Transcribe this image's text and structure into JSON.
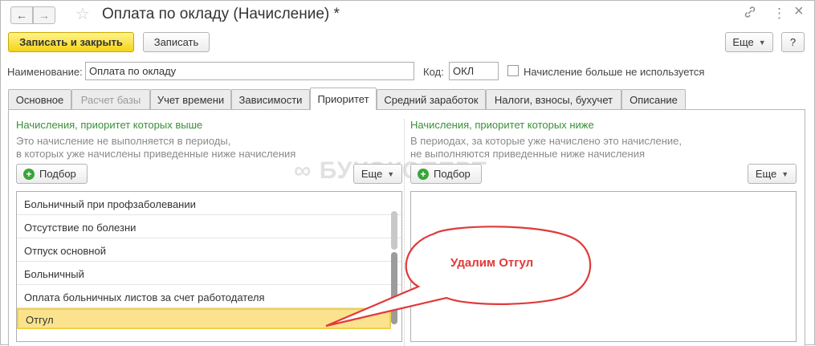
{
  "window": {
    "title": "Оплата по окладу (Начисление) *",
    "back_icon": "←",
    "forward_icon": "→",
    "star_icon": "☆",
    "link_icon": "🔗",
    "more_icon": "⋮",
    "close_icon": "×"
  },
  "toolbar": {
    "save_close_label": "Записать и закрыть",
    "save_label": "Записать",
    "more_label": "Еще",
    "help_label": "?"
  },
  "fields": {
    "name_label": "Наименование:",
    "name_value": "Оплата по окладу",
    "code_label": "Код:",
    "code_value": "ОКЛ",
    "unused_label": "Начисление больше не используется",
    "unused_checked": false
  },
  "tabs": [
    {
      "label": "Основное",
      "state": "normal"
    },
    {
      "label": "Расчет базы",
      "state": "disabled"
    },
    {
      "label": "Учет времени",
      "state": "normal"
    },
    {
      "label": "Зависимости",
      "state": "normal"
    },
    {
      "label": "Приоритет",
      "state": "active"
    },
    {
      "label": "Средний заработок",
      "state": "normal"
    },
    {
      "label": "Налоги, взносы, бухучет",
      "state": "normal"
    },
    {
      "label": "Описание",
      "state": "normal"
    }
  ],
  "left": {
    "heading": "Начисления, приоритет которых выше",
    "desc_line1": "Это начисление не выполняется в периоды,",
    "desc_line2": "в которых уже начислены приведенные ниже начисления",
    "pick_label": "Подбор",
    "more_label": "Еще",
    "items": [
      "Больничный при профзаболевании",
      "Отсутствие по болезни",
      "Отпуск основной",
      "Больничный",
      "Оплата больничных листов за счет работодателя",
      "Отгул"
    ],
    "selected_index": 5
  },
  "right": {
    "heading": "Начисления, приоритет которых ниже",
    "desc_line1": "В периодах, за которые уже начислено это начисление,",
    "desc_line2": "не выполняются приведенные ниже начисления",
    "pick_label": "Подбор",
    "more_label": "Еще",
    "items": []
  },
  "watermark": "БУХЭКСПЕРТ",
  "callout": {
    "text": "Удалим Отгул",
    "stroke_color": "#e03a3a"
  },
  "colors": {
    "primary_button": "#f4d418",
    "heading_green": "#3a8f3a",
    "selected_row": "#fbe38e"
  }
}
